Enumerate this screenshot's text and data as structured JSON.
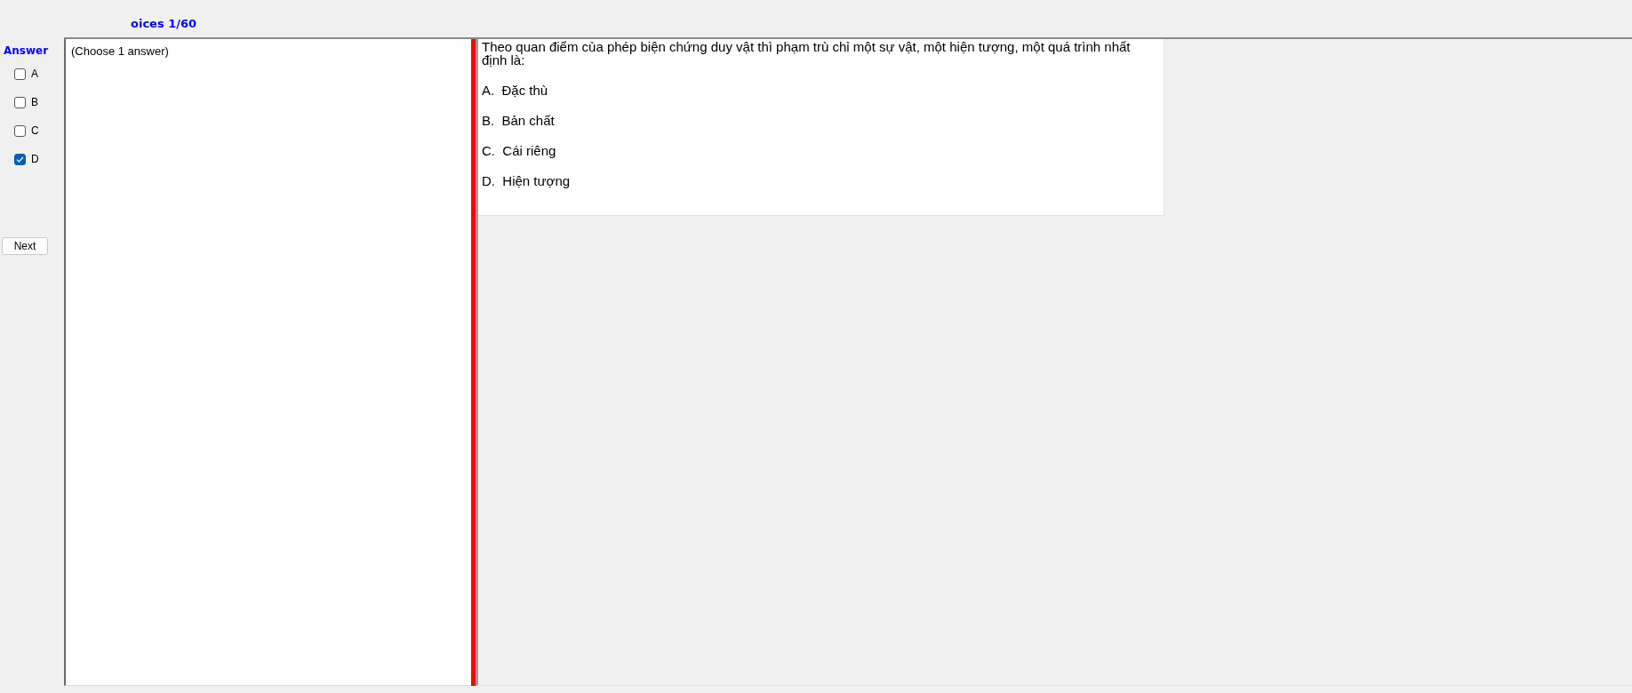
{
  "header": {
    "title": "oices 1/60"
  },
  "answer_panel": {
    "heading": "Answer",
    "options": [
      {
        "label": "A",
        "checked": false
      },
      {
        "label": "B",
        "checked": false
      },
      {
        "label": "C",
        "checked": false
      },
      {
        "label": "D",
        "checked": true
      }
    ],
    "next_button": "Next"
  },
  "instructions": "(Choose 1 answer)",
  "question": {
    "text": "Theo quan điểm của phép biện chứng duy vật thì phạm trù chỉ một sự vật, một hiện tượng, một quá trình nhất định là:",
    "options": [
      "A.  Đặc thù",
      "B.  Bản chất",
      "C.  Cái riêng",
      "D.  Hiện tượng"
    ]
  }
}
